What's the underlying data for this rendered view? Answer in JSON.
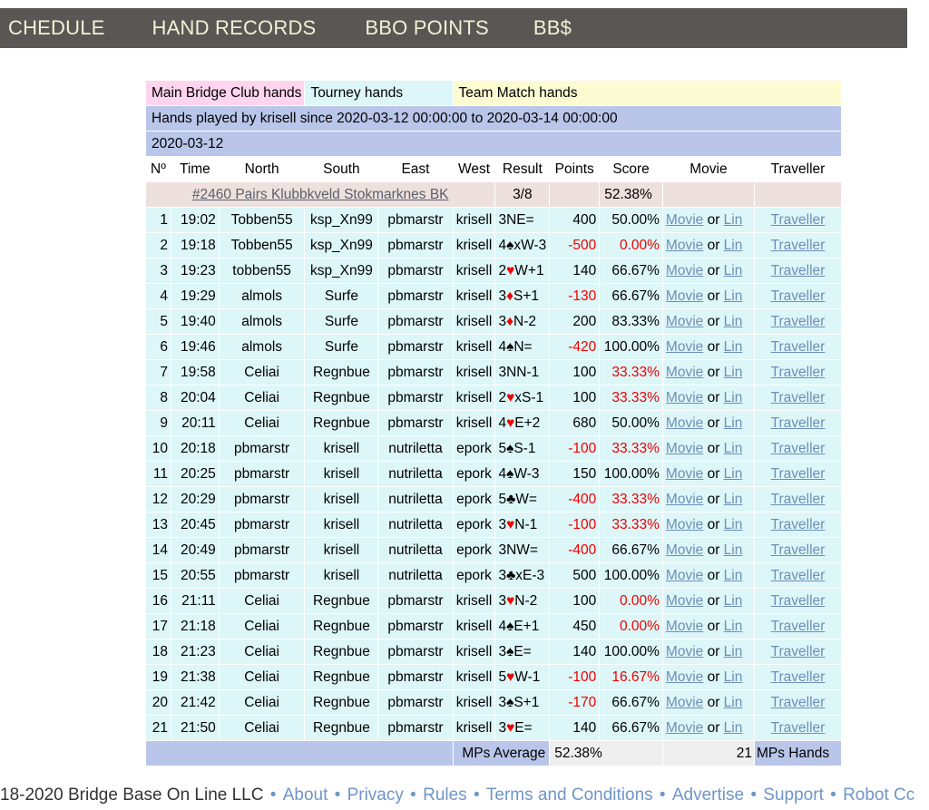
{
  "nav": {
    "items": [
      {
        "label": "CHEDULE",
        "name": "nav-schedule"
      },
      {
        "label": "HAND RECORDS",
        "name": "nav-hand-records"
      },
      {
        "label": "BBO POINTS",
        "name": "nav-bbo-points"
      },
      {
        "label": "BB$",
        "name": "nav-bb-dollars"
      }
    ],
    "background": "#595753",
    "text_color": "#f3f0d8"
  },
  "categories": {
    "main": "Main Bridge Club hands",
    "tourney": "Tourney hands",
    "team": "Team Match hands",
    "main_color": "#ffd4ee",
    "tourney_color": "#ddf6f8",
    "team_color": "#fcfbd2"
  },
  "banner": "Hands played by krisell since 2020-03-12 00:00:00 to 2020-03-14 00:00:00",
  "date_group": "2020-03-12",
  "columns": {
    "no": "Nº",
    "time": "Time",
    "north": "North",
    "south": "South",
    "east": "East",
    "west": "West",
    "result": "Result",
    "points": "Points",
    "score": "Score",
    "movie": "Movie",
    "traveller": "Traveller"
  },
  "tournament": {
    "id": "#2460",
    "name": "Pairs Klubbkveld Stokmarknes BK",
    "link_text": "#2460 Pairs Klubbkveld Stokmarknes BK",
    "placing": "3/8",
    "points": "",
    "score": "52.38%"
  },
  "links": {
    "movie": "Movie",
    "or": " or ",
    "lin": "Lin",
    "traveller": "Traveller",
    "link_color": "#6d8fb8"
  },
  "rows": [
    {
      "no": "1",
      "time": "19:02",
      "north": "Tobben55",
      "south": "ksp_Xn99",
      "east": "pbmarstr",
      "west": "krisell",
      "contract": "3N",
      "suit": "",
      "suit_color": "",
      "x": "",
      "decl_res": "E=",
      "points": "400",
      "points_neg": false,
      "score": "50.00%",
      "score_neg": false
    },
    {
      "no": "2",
      "time": "19:18",
      "north": "Tobben55",
      "south": "ksp_Xn99",
      "east": "pbmarstr",
      "west": "krisell",
      "contract": "4",
      "suit": "♠",
      "suit_color": "black",
      "x": "x",
      "decl_res": "W-3",
      "points": "-500",
      "points_neg": true,
      "score": "0.00%",
      "score_neg": true
    },
    {
      "no": "3",
      "time": "19:23",
      "north": "tobben55",
      "south": "ksp_Xn99",
      "east": "pbmarstr",
      "west": "krisell",
      "contract": "2",
      "suit": "♥",
      "suit_color": "red",
      "x": "",
      "decl_res": "W+1",
      "points": "140",
      "points_neg": false,
      "score": "66.67%",
      "score_neg": false
    },
    {
      "no": "4",
      "time": "19:29",
      "north": "almols",
      "south": "Surfe",
      "east": "pbmarstr",
      "west": "krisell",
      "contract": "3",
      "suit": "♦",
      "suit_color": "red",
      "x": "",
      "decl_res": "S+1",
      "points": "-130",
      "points_neg": true,
      "score": "66.67%",
      "score_neg": false
    },
    {
      "no": "5",
      "time": "19:40",
      "north": "almols",
      "south": "Surfe",
      "east": "pbmarstr",
      "west": "krisell",
      "contract": "3",
      "suit": "♦",
      "suit_color": "red",
      "x": "",
      "decl_res": "N-2",
      "points": "200",
      "points_neg": false,
      "score": "83.33%",
      "score_neg": false
    },
    {
      "no": "6",
      "time": "19:46",
      "north": "almols",
      "south": "Surfe",
      "east": "pbmarstr",
      "west": "krisell",
      "contract": "4",
      "suit": "♠",
      "suit_color": "black",
      "x": "",
      "decl_res": "N=",
      "points": "-420",
      "points_neg": true,
      "score": "100.00%",
      "score_neg": false
    },
    {
      "no": "7",
      "time": "19:58",
      "north": "Celiai",
      "south": "Regnbue",
      "east": "pbmarstr",
      "west": "krisell",
      "contract": "3N",
      "suit": "",
      "suit_color": "",
      "x": "",
      "decl_res": "N-1",
      "points": "100",
      "points_neg": false,
      "score": "33.33%",
      "score_neg": true
    },
    {
      "no": "8",
      "time": "20:04",
      "north": "Celiai",
      "south": "Regnbue",
      "east": "pbmarstr",
      "west": "krisell",
      "contract": "2",
      "suit": "♥",
      "suit_color": "red",
      "x": "x",
      "decl_res": "S-1",
      "points": "100",
      "points_neg": false,
      "score": "33.33%",
      "score_neg": true
    },
    {
      "no": "9",
      "time": "20:11",
      "north": "Celiai",
      "south": "Regnbue",
      "east": "pbmarstr",
      "west": "krisell",
      "contract": "4",
      "suit": "♥",
      "suit_color": "red",
      "x": "",
      "decl_res": "E+2",
      "points": "680",
      "points_neg": false,
      "score": "50.00%",
      "score_neg": false
    },
    {
      "no": "10",
      "time": "20:18",
      "north": "pbmarstr",
      "south": "krisell",
      "east": "nutriletta",
      "west": "epork",
      "contract": "5",
      "suit": "♠",
      "suit_color": "black",
      "x": "",
      "decl_res": "S-1",
      "points": "-100",
      "points_neg": true,
      "score": "33.33%",
      "score_neg": true
    },
    {
      "no": "11",
      "time": "20:25",
      "north": "pbmarstr",
      "south": "krisell",
      "east": "nutriletta",
      "west": "epork",
      "contract": "4",
      "suit": "♠",
      "suit_color": "black",
      "x": "",
      "decl_res": "W-3",
      "points": "150",
      "points_neg": false,
      "score": "100.00%",
      "score_neg": false
    },
    {
      "no": "12",
      "time": "20:29",
      "north": "pbmarstr",
      "south": "krisell",
      "east": "nutriletta",
      "west": "epork",
      "contract": "5",
      "suit": "♣",
      "suit_color": "black",
      "x": "",
      "decl_res": "W=",
      "points": "-400",
      "points_neg": true,
      "score": "33.33%",
      "score_neg": true
    },
    {
      "no": "13",
      "time": "20:45",
      "north": "pbmarstr",
      "south": "krisell",
      "east": "nutriletta",
      "west": "epork",
      "contract": "3",
      "suit": "♥",
      "suit_color": "red",
      "x": "",
      "decl_res": "N-1",
      "points": "-100",
      "points_neg": true,
      "score": "33.33%",
      "score_neg": true
    },
    {
      "no": "14",
      "time": "20:49",
      "north": "pbmarstr",
      "south": "krisell",
      "east": "nutriletta",
      "west": "epork",
      "contract": "3N",
      "suit": "",
      "suit_color": "",
      "x": "",
      "decl_res": "W=",
      "points": "-400",
      "points_neg": true,
      "score": "66.67%",
      "score_neg": false
    },
    {
      "no": "15",
      "time": "20:55",
      "north": "pbmarstr",
      "south": "krisell",
      "east": "nutriletta",
      "west": "epork",
      "contract": "3",
      "suit": "♣",
      "suit_color": "black",
      "x": "x",
      "decl_res": "E-3",
      "points": "500",
      "points_neg": false,
      "score": "100.00%",
      "score_neg": false
    },
    {
      "no": "16",
      "time": "21:11",
      "north": "Celiai",
      "south": "Regnbue",
      "east": "pbmarstr",
      "west": "krisell",
      "contract": "3",
      "suit": "♥",
      "suit_color": "red",
      "x": "",
      "decl_res": "N-2",
      "points": "100",
      "points_neg": false,
      "score": "0.00%",
      "score_neg": true
    },
    {
      "no": "17",
      "time": "21:18",
      "north": "Celiai",
      "south": "Regnbue",
      "east": "pbmarstr",
      "west": "krisell",
      "contract": "4",
      "suit": "♠",
      "suit_color": "black",
      "x": "",
      "decl_res": "E+1",
      "points": "450",
      "points_neg": false,
      "score": "0.00%",
      "score_neg": true
    },
    {
      "no": "18",
      "time": "21:23",
      "north": "Celiai",
      "south": "Regnbue",
      "east": "pbmarstr",
      "west": "krisell",
      "contract": "3",
      "suit": "♠",
      "suit_color": "black",
      "x": "",
      "decl_res": "E=",
      "points": "140",
      "points_neg": false,
      "score": "100.00%",
      "score_neg": false
    },
    {
      "no": "19",
      "time": "21:38",
      "north": "Celiai",
      "south": "Regnbue",
      "east": "pbmarstr",
      "west": "krisell",
      "contract": "5",
      "suit": "♥",
      "suit_color": "red",
      "x": "",
      "decl_res": "W-1",
      "points": "-100",
      "points_neg": true,
      "score": "16.67%",
      "score_neg": true
    },
    {
      "no": "20",
      "time": "21:42",
      "north": "Celiai",
      "south": "Regnbue",
      "east": "pbmarstr",
      "west": "krisell",
      "contract": "3",
      "suit": "♠",
      "suit_color": "black",
      "x": "",
      "decl_res": "S+1",
      "points": "-170",
      "points_neg": true,
      "score": "66.67%",
      "score_neg": false
    },
    {
      "no": "21",
      "time": "21:50",
      "north": "Celiai",
      "south": "Regnbue",
      "east": "pbmarstr",
      "west": "krisell",
      "contract": "3",
      "suit": "♥",
      "suit_color": "red",
      "x": "",
      "decl_res": "E=",
      "points": "140",
      "points_neg": false,
      "score": "66.67%",
      "score_neg": false
    }
  ],
  "summary": {
    "label": "MPs Average",
    "value": "52.38%",
    "count": "21",
    "count_label": "MPs Hands"
  },
  "footer": {
    "copyright": "18-2020 Bridge Base On Line LLC",
    "links": [
      "About",
      "Privacy",
      "Rules",
      "Terms and Conditions",
      "Advertise",
      "Support",
      "Robot Cc"
    ],
    "separator": "•"
  }
}
